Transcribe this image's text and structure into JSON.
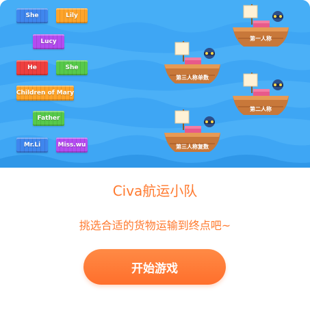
{
  "game": {
    "title": "Civa航运小队",
    "subtitle": "挑选合适的货物运输到终点吧~",
    "start_button": "开始游戏"
  },
  "crates": [
    {
      "label": "She",
      "color": "#3f86ee"
    },
    {
      "label": "Lily",
      "color": "#ffa42a"
    },
    {
      "label": "Lucy",
      "color": "#b44cf0"
    },
    {
      "label": "He",
      "color": "#ef3f3f"
    },
    {
      "label": "She",
      "color": "#57c94a"
    },
    {
      "label": "Children of Mary",
      "color": "#ffa42a"
    },
    {
      "label": "Father",
      "color": "#57c94a"
    },
    {
      "label": "Mr.Li",
      "color": "#3f86ee"
    },
    {
      "label": "Miss.wu",
      "color": "#b44cf0"
    }
  ],
  "ships": [
    {
      "label": "第一人称",
      "icon": "ship-icon"
    },
    {
      "label": "第三人称单数",
      "icon": "ship-icon"
    },
    {
      "label": "第二人称",
      "icon": "ship-icon"
    },
    {
      "label": "第三人称复数",
      "icon": "ship-icon"
    }
  ],
  "colors": {
    "sky": "#3fa9f5",
    "wave": "#5bbcf8",
    "accent": "#ff7a2f"
  }
}
